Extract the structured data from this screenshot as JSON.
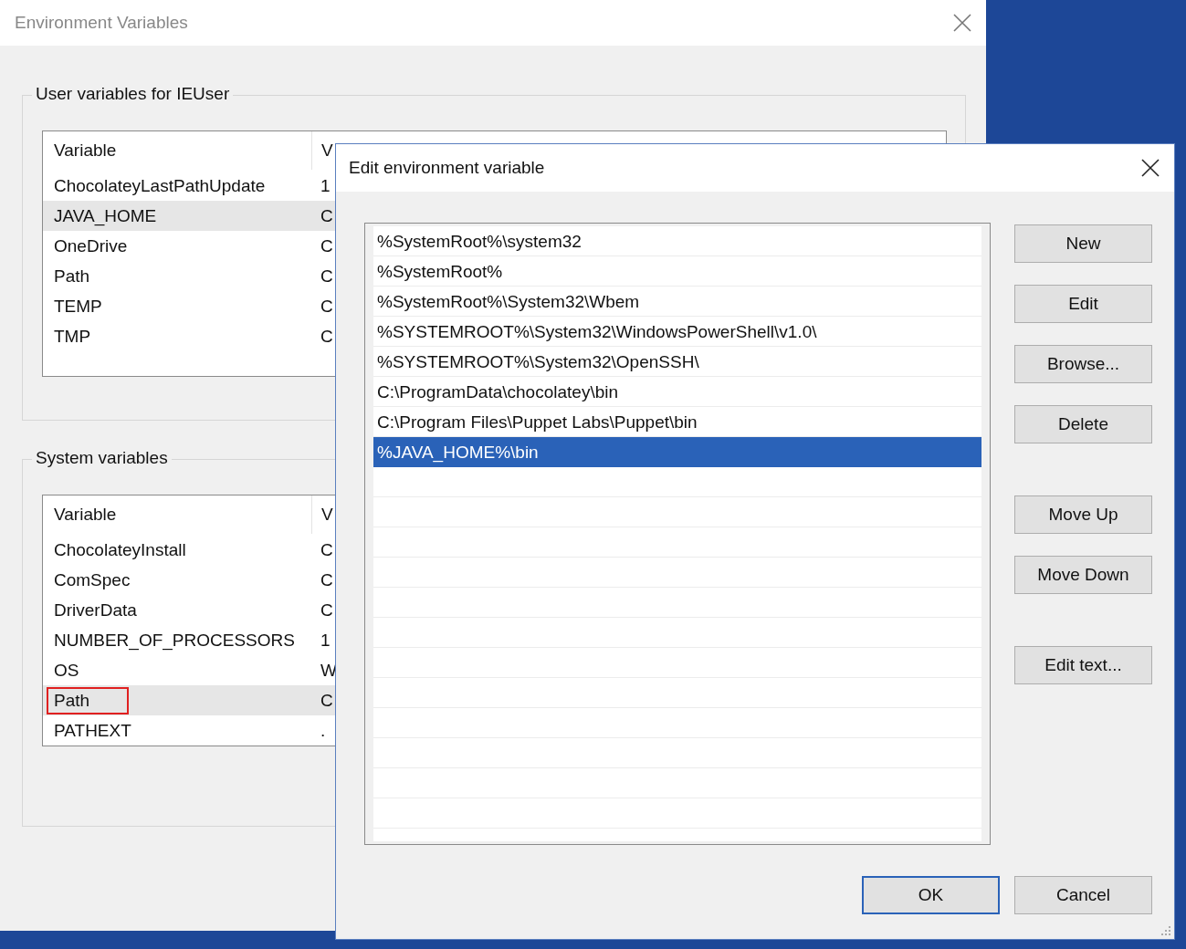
{
  "background_window": {
    "title": "Environment Variables",
    "user_group": {
      "label": "User variables for IEUser",
      "columns": [
        "Variable",
        "V"
      ],
      "rows": [
        {
          "variable": "ChocolateyLastPathUpdate",
          "value": "1",
          "selected": false,
          "annotated": false
        },
        {
          "variable": "JAVA_HOME",
          "value": "C",
          "selected": true,
          "annotated": false
        },
        {
          "variable": "OneDrive",
          "value": "C",
          "selected": false,
          "annotated": false
        },
        {
          "variable": "Path",
          "value": "C",
          "selected": false,
          "annotated": false
        },
        {
          "variable": "TEMP",
          "value": "C",
          "selected": false,
          "annotated": false
        },
        {
          "variable": "TMP",
          "value": "C",
          "selected": false,
          "annotated": false
        }
      ]
    },
    "system_group": {
      "label": "System variables",
      "columns": [
        "Variable",
        "V"
      ],
      "rows": [
        {
          "variable": "ChocolateyInstall",
          "value": "C",
          "selected": false,
          "annotated": false
        },
        {
          "variable": "ComSpec",
          "value": "C",
          "selected": false,
          "annotated": false
        },
        {
          "variable": "DriverData",
          "value": "C",
          "selected": false,
          "annotated": false
        },
        {
          "variable": "NUMBER_OF_PROCESSORS",
          "value": "1",
          "selected": false,
          "annotated": false
        },
        {
          "variable": "OS",
          "value": "W",
          "selected": false,
          "annotated": false
        },
        {
          "variable": "Path",
          "value": "C",
          "selected": true,
          "annotated": true
        },
        {
          "variable": "PATHEXT",
          "value": ".",
          "selected": false,
          "annotated": false
        }
      ]
    }
  },
  "dialog": {
    "title": "Edit environment variable",
    "entries": [
      {
        "text": "%SystemRoot%\\system32",
        "selected": false
      },
      {
        "text": "%SystemRoot%",
        "selected": false
      },
      {
        "text": "%SystemRoot%\\System32\\Wbem",
        "selected": false
      },
      {
        "text": "%SYSTEMROOT%\\System32\\WindowsPowerShell\\v1.0\\",
        "selected": false
      },
      {
        "text": "%SYSTEMROOT%\\System32\\OpenSSH\\",
        "selected": false
      },
      {
        "text": "C:\\ProgramData\\chocolatey\\bin",
        "selected": false
      },
      {
        "text": "C:\\Program Files\\Puppet Labs\\Puppet\\bin",
        "selected": false
      },
      {
        "text": "%JAVA_HOME%\\bin",
        "selected": true
      }
    ],
    "button_groups": [
      [
        "New",
        "Edit",
        "Browse...",
        "Delete"
      ],
      [
        "Move Up",
        "Move Down"
      ],
      [
        "Edit text..."
      ]
    ],
    "ok": "OK",
    "cancel": "Cancel"
  }
}
